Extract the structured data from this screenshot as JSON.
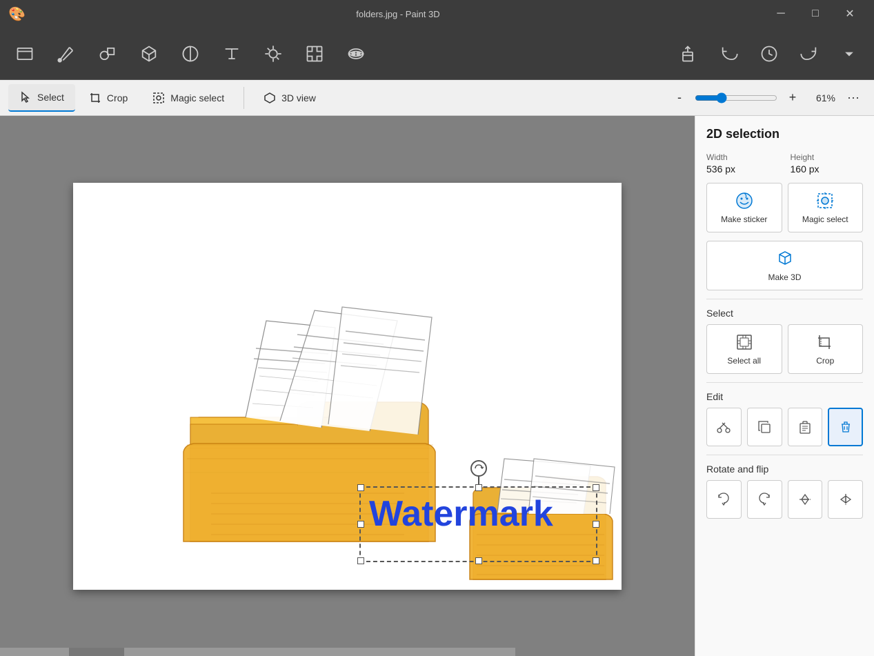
{
  "titleBar": {
    "title": "folders.jpg - Paint 3D",
    "minBtn": "─",
    "maxBtn": "□",
    "closeBtn": "✕"
  },
  "toolbarStrip": {
    "tools": [
      {
        "id": "open",
        "icon": "open",
        "label": ""
      },
      {
        "id": "pencil",
        "icon": "pencil",
        "label": ""
      },
      {
        "id": "select2d",
        "icon": "select2d",
        "label": ""
      },
      {
        "id": "object3d",
        "icon": "object3d",
        "label": ""
      },
      {
        "id": "sticker",
        "icon": "sticker",
        "label": ""
      },
      {
        "id": "text",
        "icon": "text",
        "label": ""
      },
      {
        "id": "effects",
        "icon": "effects",
        "label": ""
      },
      {
        "id": "canvas",
        "icon": "canvas",
        "label": ""
      },
      {
        "id": "mixed",
        "icon": "mixed",
        "label": ""
      }
    ],
    "undoBtn": "↩",
    "historyBtn": "🕐",
    "redoBtn": "↪",
    "moreBtn": "⌄"
  },
  "secondaryToolbar": {
    "selectBtn": "Select",
    "cropBtn": "Crop",
    "magicSelectBtn": "Magic select",
    "view3dBtn": "3D view",
    "zoomMin": "-",
    "zoomMax": "+",
    "zoomValue": 61,
    "zoomLabel": "61%",
    "moreBtn": "···"
  },
  "canvas": {
    "watermarkText": "Watermark"
  },
  "rightPanel": {
    "title": "2D selection",
    "widthLabel": "Width",
    "widthValue": "536 px",
    "heightLabel": "Height",
    "heightValue": "160 px",
    "makeStickerLabel": "Make sticker",
    "magicSelectLabel": "Magic select",
    "make3dLabel": "Make 3D",
    "selectLabel": "Select",
    "selectAllLabel": "Select all",
    "cropLabel": "Crop",
    "editLabel": "Edit",
    "cutLabel": "Cut",
    "copyLabel": "Copy",
    "pasteLabel": "Paste",
    "deleteLabel": "Delete",
    "rotateFlipLabel": "Rotate and flip",
    "rotateLeftLabel": "Rotate left",
    "rotateRightLabel": "Rotate right",
    "flipVertLabel": "Flip vertical",
    "flipHorizLabel": "Flip horizontal"
  }
}
